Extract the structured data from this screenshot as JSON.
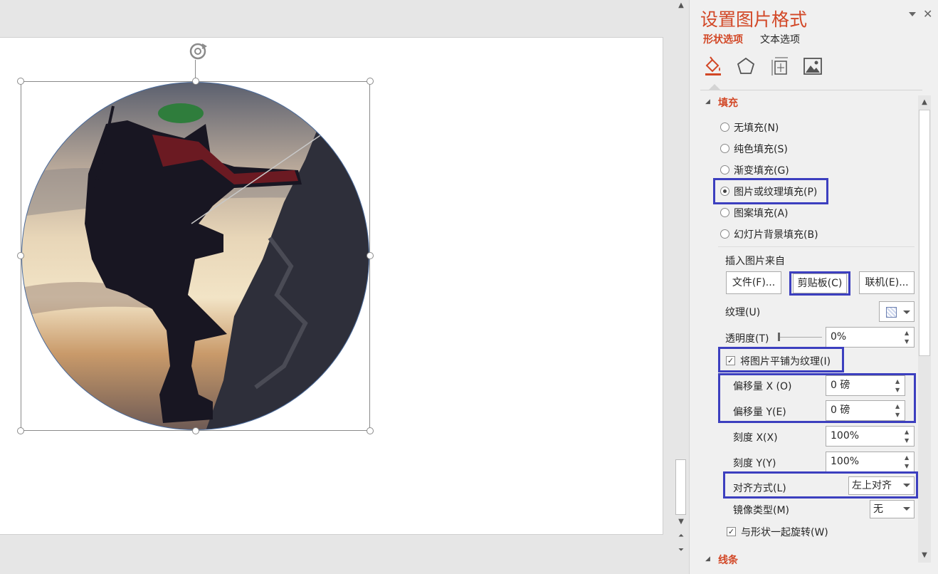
{
  "pane": {
    "title": "设置图片格式",
    "tabs": [
      "形状选项",
      "文本选项"
    ],
    "fill_section": "填充",
    "line_section": "线条",
    "radio_options": [
      {
        "label": "无填充(N)",
        "selected": false
      },
      {
        "label": "纯色填充(S)",
        "selected": false
      },
      {
        "label": "渐变填充(G)",
        "selected": false
      },
      {
        "label": "图片或纹理填充(P)",
        "selected": true
      },
      {
        "label": "图案填充(A)",
        "selected": false
      },
      {
        "label": "幻灯片背景填充(B)",
        "selected": false
      }
    ],
    "insert_from": "插入图片来自",
    "buttons": {
      "file": "文件(F)...",
      "clipboard": "剪贴板(C)",
      "online": "联机(E)..."
    },
    "texture_label": "纹理(U)",
    "transparency": {
      "label": "透明度(T)",
      "value": "0%"
    },
    "tile_checkbox": {
      "label": "将图片平铺为纹理(I)",
      "checked": true
    },
    "offset_x": {
      "label": "偏移量 X (O)",
      "value": "0 磅"
    },
    "offset_y": {
      "label": "偏移量 Y(E)",
      "value": "0 磅"
    },
    "scale_x": {
      "label": "刻度 X(X)",
      "value": "100%"
    },
    "scale_y": {
      "label": "刻度 Y(Y)",
      "value": "100%"
    },
    "alignment": {
      "label": "对齐方式(L)",
      "value": "左上对齐"
    },
    "mirror": {
      "label": "镜像类型(M)",
      "value": "无"
    },
    "rotate_checkbox": {
      "label": "与形状一起旋转(W)",
      "checked": true
    }
  },
  "colors": {
    "accent": "#d24726",
    "highlight": "#3c3fbf"
  },
  "icons": [
    "rotate-handle-icon",
    "fill-line-icon",
    "effects-pentagon-icon",
    "size-properties-icon",
    "picture-icon",
    "close-icon",
    "pane-menu-icon"
  ]
}
